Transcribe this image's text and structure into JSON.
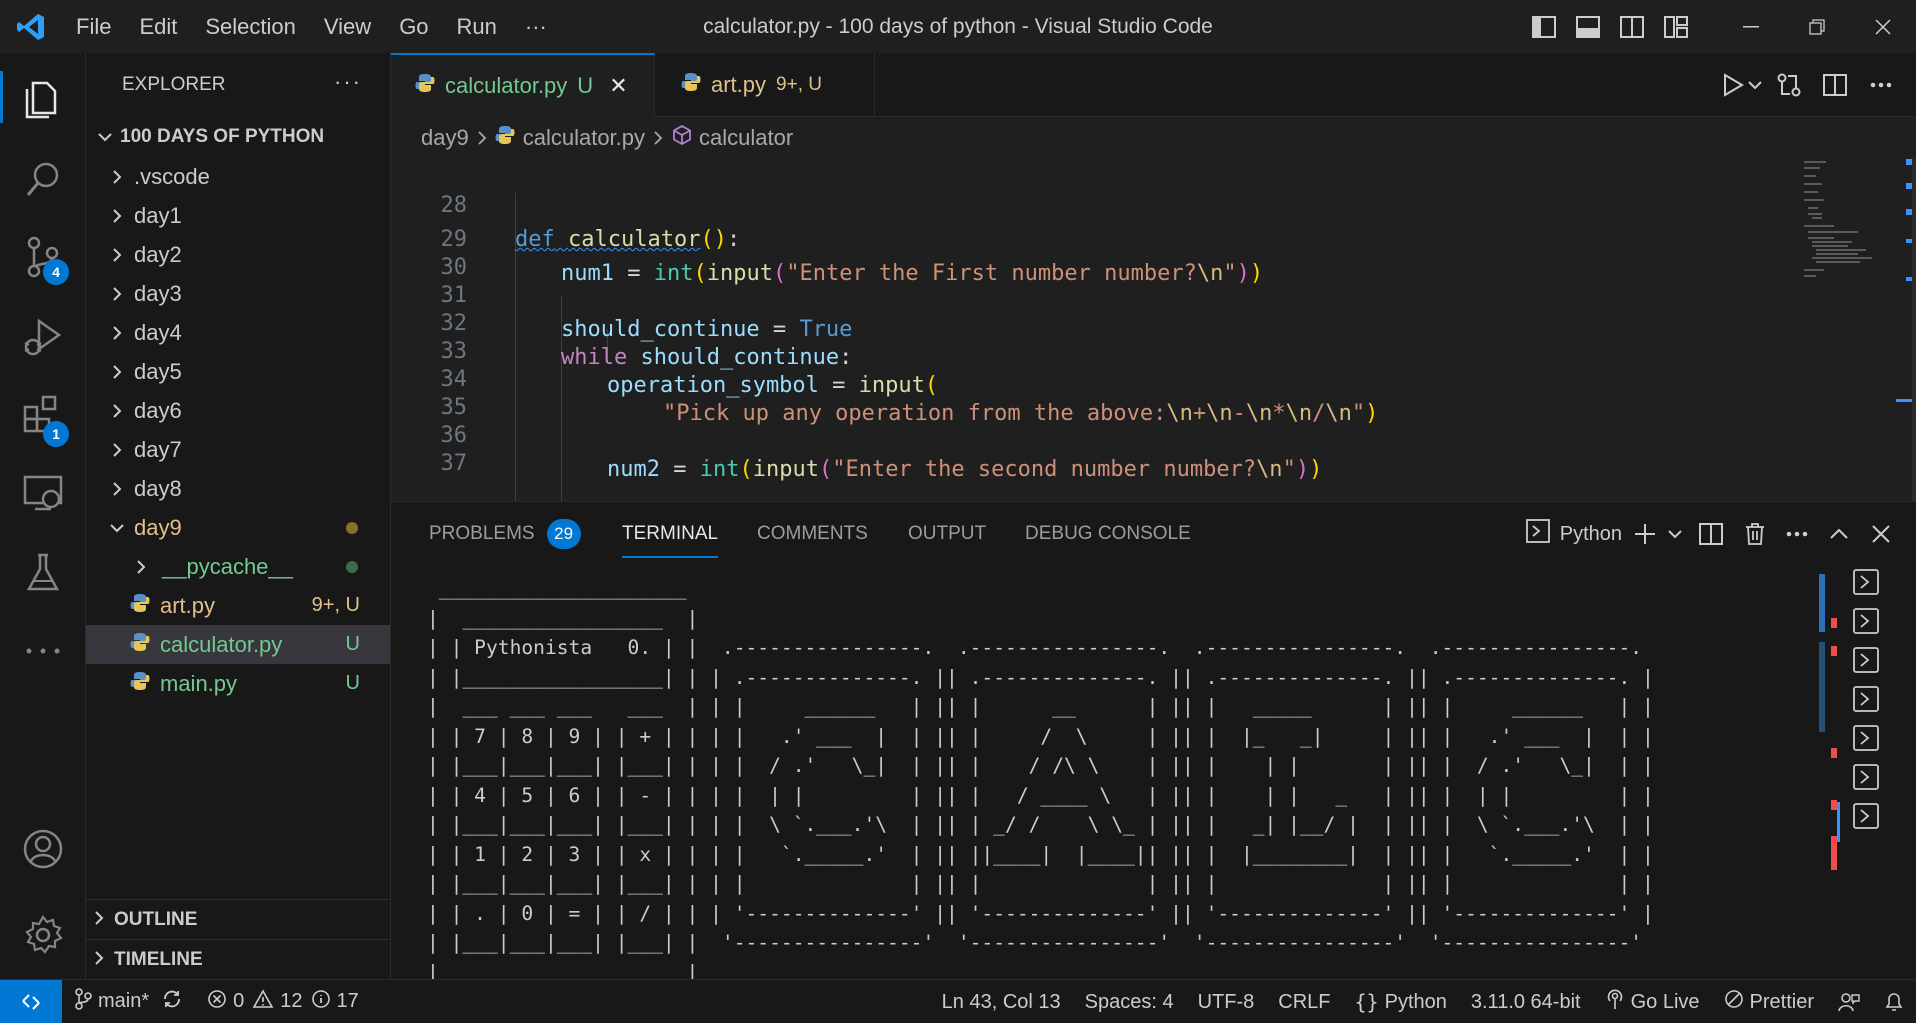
{
  "window": {
    "title": "calculator.py - 100 days of python - Visual Studio Code",
    "menu": [
      "File",
      "Edit",
      "Selection",
      "View",
      "Go",
      "Run",
      "···"
    ]
  },
  "activity": {
    "scm_badge": "4",
    "extensions_badge": "1"
  },
  "explorer": {
    "title": "EXPLORER",
    "more": "···",
    "folder": "100 DAYS OF PYTHON",
    "items": [
      {
        "label": ".vscode"
      },
      {
        "label": "day1"
      },
      {
        "label": "day2"
      },
      {
        "label": "day3"
      },
      {
        "label": "day4"
      },
      {
        "label": "day5"
      },
      {
        "label": "day6"
      },
      {
        "label": "day7"
      },
      {
        "label": "day8"
      },
      {
        "label": "day9"
      },
      {
        "label": "__pycache__"
      },
      {
        "label": "art.py",
        "status": "9+, U"
      },
      {
        "label": "calculator.py",
        "status": "U"
      },
      {
        "label": "main.py",
        "status": "U"
      }
    ],
    "outline": "OUTLINE",
    "timeline": "TIMELINE"
  },
  "tabs": [
    {
      "label": "calculator.py",
      "status": "U",
      "close": "✕"
    },
    {
      "label": "art.py",
      "status": "9+, U"
    }
  ],
  "breadcrumb": {
    "folder": "day9",
    "file": "calculator.py",
    "symbol": "calculator"
  },
  "code": {
    "line_numbers": [
      "28",
      "29",
      "30",
      "31",
      "32",
      "33",
      "34",
      "35",
      "36",
      "37"
    ],
    "l28": {
      "def": "def",
      "name": "calculator",
      "open": "(",
      "close": ")",
      "colon": ":"
    },
    "l29": {
      "var": "num1",
      "eq": " = ",
      "int": "int",
      "p1o": "(",
      "input": "input",
      "p2o": "(",
      "str": "\"Enter the First number number?",
      "esc": "\\n",
      "strend": "\"",
      "p2c": ")",
      "p1c": ")"
    },
    "l31": {
      "var": "should_continue",
      "eq": " = ",
      "val": "True"
    },
    "l32": {
      "kw": "while",
      "var": "should_continue",
      "colon": ":"
    },
    "l33": {
      "var": "operation_symbol",
      "eq": " = ",
      "input": "input",
      "p": "("
    },
    "l34": {
      "str1": "\"Pick up any operation from the above:",
      "esc1": "\\n",
      "mid1": "+",
      "esc2": "\\n",
      "mid2": "-",
      "esc3": "\\n",
      "mid3": "*",
      "esc4": "\\n",
      "mid4": "/",
      "esc5": "\\n",
      "strend": "\"",
      "p": ")"
    },
    "l36": {
      "var": "num2",
      "eq": " = ",
      "int": "int",
      "p1o": "(",
      "input": "input",
      "p2o": "(",
      "str": "\"Enter the second number number?",
      "esc": "\\n",
      "strend": "\"",
      "p2c": ")",
      "p1c": ")"
    }
  },
  "panel": {
    "tabs": [
      "PROBLEMS",
      "TERMINAL",
      "COMMENTS",
      "OUTPUT",
      "DEBUG CONSOLE"
    ],
    "problems_count": "29",
    "terminal_name": "Python",
    "terminal_output": " _____________________\n|  _________________  |\n| | Pythonista   0. | |  .----------------.  .----------------.  .----------------.  .----------------.\n| |_________________| | | .--------------. || .--------------. || .--------------. || .--------------. |\n|  ___ ___ ___   ___  | | |     ______   | || |      __      | || |   _____      | || |     ______   | |\n| | 7 | 8 | 9 | | + | | | |   .' ___  |  | || |     /  \\     | || |  |_   _|     | || |   .' ___  |  | |\n| |___|___|___| |___| | | |  / .'   \\_|  | || |    / /\\ \\    | || |    | |       | || |  / .'   \\_|  | |\n| | 4 | 5 | 6 | | - | | | |  | |         | || |   / ____ \\   | || |    | |   _   | || |  | |         | |\n| |___|___|___| |___| | | |  \\ `.___.'\\  | || | _/ /    \\ \\_ | || |   _| |__/ |  | || |  \\ `.___.'\\  | |\n| | 1 | 2 | 3 | | x | | | |   `._____.'  | || ||____|  |____|| || |  |________|  | || |   `._____.'  | |\n| |___|___|___| |___| | | |              | || |              | || |              | || |              | |\n| | . | 0 | = | | / | | | '--------------' || '--------------' || '--------------' || '--------------' |\n| |___|___|___| |___| |  '----------------'  '----------------'  '----------------'  '----------------'\n|_____________________|"
  },
  "statusbar": {
    "branch": "main*",
    "errors": "0",
    "warnings": "12",
    "infos": "17",
    "position": "Ln 43, Col 13",
    "spaces": "Spaces: 4",
    "encoding": "UTF-8",
    "eol": "CRLF",
    "language": "Python",
    "interpreter": "3.11.0 64-bit",
    "golive": "Go Live",
    "prettier": "Prettier"
  },
  "colors": {
    "accent": "#0078d4",
    "untracked": "#73c991",
    "modified": "#e2c08d",
    "folder_modified": "#8c6d2f"
  }
}
